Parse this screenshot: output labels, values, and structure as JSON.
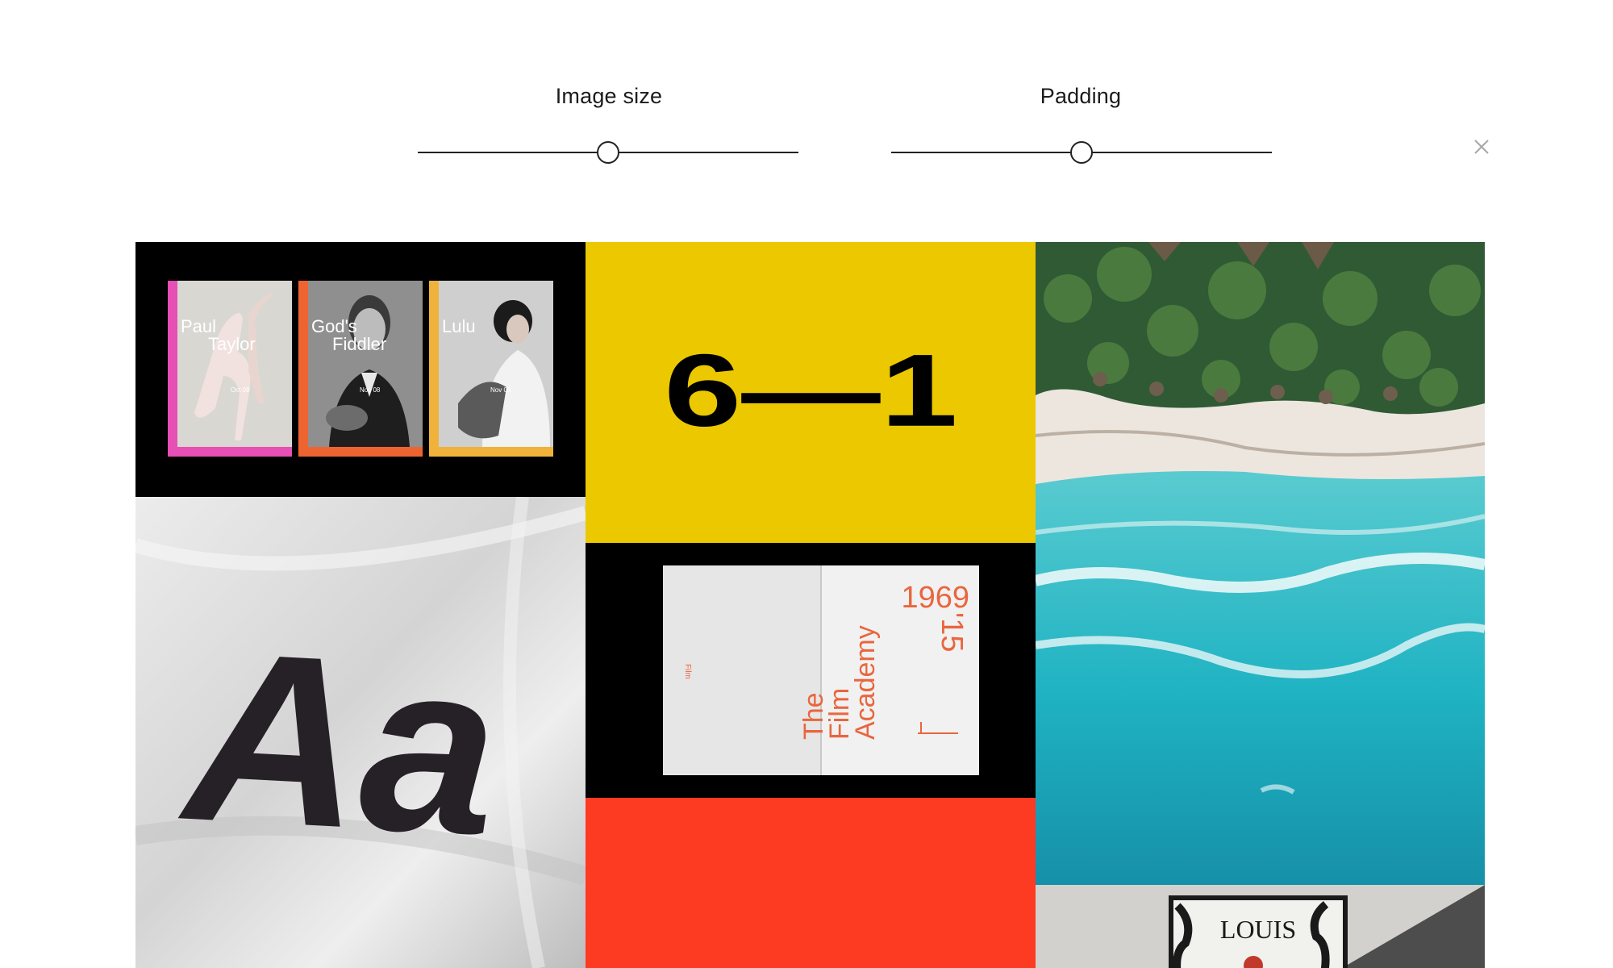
{
  "controls": {
    "image_size": {
      "label": "Image size",
      "value": 0.5
    },
    "padding": {
      "label": "Padding",
      "value": 0.5
    },
    "close_icon": "close-icon"
  },
  "gallery": {
    "posters": [
      {
        "title_line1": "Paul",
        "title_line2": "Taylor",
        "date": "Oct 08",
        "color": "#e64fb4"
      },
      {
        "title_line1": "God's",
        "title_line2": "Fiddler",
        "date": "Nov 08",
        "color": "#ee6430"
      },
      {
        "title_line1": "Lulu",
        "title_line2": "",
        "date": "Nov 08",
        "color": "#efb23a"
      }
    ],
    "score": {
      "text": "6—1",
      "background": "#ebc800"
    },
    "book": {
      "years": "1969",
      "years_rotated": "'15",
      "title_line1": "The",
      "title_line2": "Film",
      "title_line3": "Academy",
      "spine_text": "Film",
      "accent": "#e9663e"
    },
    "type_specimen": {
      "text": "Aa"
    },
    "red_block": {
      "color": "#fd3a22"
    },
    "magazine": {
      "title": "LOUIS"
    }
  }
}
